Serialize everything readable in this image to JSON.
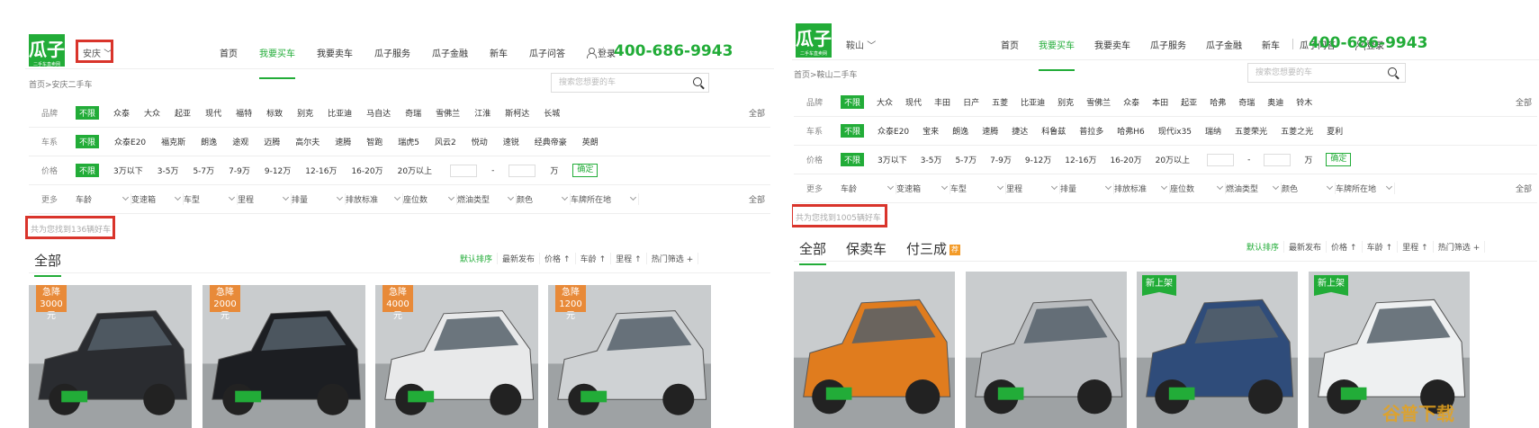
{
  "left": {
    "logo": {
      "title": "瓜子",
      "subtitle": "二手车直卖网"
    },
    "city": "安庆",
    "nav": [
      "首页",
      "我要买车",
      "我要卖车",
      "瓜子服务",
      "瓜子金融",
      "新车",
      "瓜子问答"
    ],
    "nav_active_index": 1,
    "login": "登录",
    "phone": "400-686-9943",
    "breadcrumb": "首页>安庆二手车",
    "search_placeholder": "搜索您想要的车",
    "filters": {
      "brand": {
        "label": "品牌",
        "options": [
          "不限",
          "众泰",
          "大众",
          "起亚",
          "现代",
          "福特",
          "标致",
          "别克",
          "比亚迪",
          "马自达",
          "奇瑞",
          "雪佛兰",
          "江淮",
          "斯柯达",
          "长城"
        ],
        "all": "全部"
      },
      "series": {
        "label": "车系",
        "options": [
          "不限",
          "众泰E20",
          "福克斯",
          "朗逸",
          "途观",
          "迈腾",
          "高尔夫",
          "速腾",
          "智跑",
          "瑞虎5",
          "风云2",
          "悦动",
          "速锐",
          "经典帝豪",
          "英朗"
        ]
      },
      "price": {
        "label": "价格",
        "options": [
          "不限",
          "3万以下",
          "3-5万",
          "5-7万",
          "7-9万",
          "9-12万",
          "12-16万",
          "16-20万",
          "20万以上"
        ],
        "range_sep": "-",
        "unit": "万",
        "confirm": "确定"
      },
      "more": {
        "label": "更多",
        "dropdowns": [
          "车龄",
          "变速箱",
          "车型",
          "里程",
          "排量",
          "排放标准",
          "座位数",
          "燃油类型",
          "颜色",
          "车牌所在地"
        ],
        "all": "全部"
      }
    },
    "result_count": "共为您找到136辆好车",
    "tabs": [
      {
        "label": "全部"
      }
    ],
    "sort": [
      "默认排序",
      "最新发布",
      "价格",
      "车龄",
      "里程",
      "热门筛选"
    ],
    "cars": [
      {
        "tag": "急降",
        "amount": "3000元",
        "color": "#2a2c30"
      },
      {
        "tag": "急降",
        "amount": "2000元",
        "color": "#1c1e22"
      },
      {
        "tag": "急降",
        "amount": "4000元",
        "color": "#e8e9ea"
      },
      {
        "tag": "急降",
        "amount": "1200元",
        "color": "#cfd2d4"
      }
    ]
  },
  "right": {
    "logo": {
      "title": "瓜子",
      "subtitle": "二手车直卖网"
    },
    "city": "鞍山",
    "nav": [
      "首页",
      "我要买车",
      "我要卖车",
      "瓜子服务",
      "瓜子金融",
      "新车",
      "瓜子问答"
    ],
    "nav_active_index": 1,
    "login": "登录",
    "phone": "400-686-9943",
    "breadcrumb": "首页>鞍山二手车",
    "search_placeholder": "搜索您想要的车",
    "filters": {
      "brand": {
        "label": "品牌",
        "options": [
          "不限",
          "大众",
          "现代",
          "丰田",
          "日产",
          "五菱",
          "比亚迪",
          "别克",
          "雪佛兰",
          "众泰",
          "本田",
          "起亚",
          "哈弗",
          "奇瑞",
          "奥迪",
          "铃木"
        ],
        "all": "全部"
      },
      "series": {
        "label": "车系",
        "options": [
          "不限",
          "众泰E20",
          "宝来",
          "朗逸",
          "速腾",
          "捷达",
          "科鲁兹",
          "普拉多",
          "哈弗H6",
          "现代ix35",
          "瑞纳",
          "五菱荣光",
          "五菱之光",
          "夏利"
        ]
      },
      "price": {
        "label": "价格",
        "options": [
          "不限",
          "3万以下",
          "3-5万",
          "5-7万",
          "7-9万",
          "9-12万",
          "12-16万",
          "16-20万",
          "20万以上"
        ],
        "range_sep": "-",
        "unit": "万",
        "confirm": "确定"
      },
      "more": {
        "label": "更多",
        "dropdowns": [
          "车龄",
          "变速箱",
          "车型",
          "里程",
          "排量",
          "排放标准",
          "座位数",
          "燃油类型",
          "颜色",
          "车牌所在地"
        ],
        "all": "全部"
      }
    },
    "result_count": "共为您找到1005辆好车",
    "tabs": [
      {
        "label": "全部"
      },
      {
        "label": "保卖车"
      },
      {
        "label": "付三成",
        "badge": "荐"
      }
    ],
    "sort": [
      "默认排序",
      "最新发布",
      "价格",
      "车龄",
      "里程",
      "热门筛选"
    ],
    "cars": [
      {
        "tag": "",
        "color": "#e07c1e"
      },
      {
        "tag": "",
        "color": "#b9bcbf"
      },
      {
        "tag": "新上架",
        "color": "#2f4c7a"
      },
      {
        "tag": "新上架",
        "color": "#eef0f1"
      }
    ],
    "watermark": "谷普下载"
  },
  "colors": {
    "brand_green": "#22ac38",
    "highlight_red": "#d9342b",
    "drop_tag": "#e88a39"
  }
}
